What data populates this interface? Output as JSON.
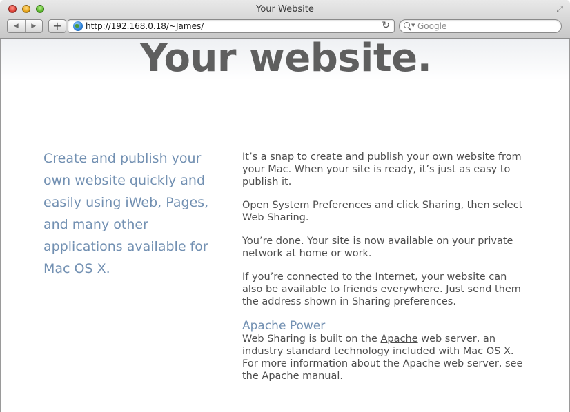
{
  "window": {
    "title": "Your Website"
  },
  "toolbar": {
    "back_icon": "back-arrow-icon",
    "forward_icon": "forward-arrow-icon",
    "add_label": "+",
    "address": "http://192.168.0.18/~James/",
    "search_placeholder": "Google"
  },
  "page": {
    "headline": "Your website.",
    "tagline": "Create and publish your own website quickly and easily using iWeb, Pages, and many other applications available for Mac OS X.",
    "paragraphs": [
      "It’s a snap to create and publish your own website from your Mac. When your site is ready, it’s just as easy to publish it.",
      "Open System Preferences and click Sharing, then select Web Sharing.",
      "You’re done. Your site is now available on your private network at home or work.",
      "If you’re connected to the Internet, your website can also be available to friends everywhere. Just send them the address shown in Sharing preferences."
    ],
    "apache": {
      "heading": "Apache Power",
      "text_before_link1": "Web Sharing is built on the ",
      "link1": "Apache",
      "text_after_link1": " web server, an industry standard technology included with Mac OS X. For more information about the Apache web server, see the ",
      "link2": "Apache manual",
      "text_end": "."
    }
  },
  "colors": {
    "headline": "#5f5f5f",
    "accent_blue": "#7290b2",
    "body_text": "#4e4e4e"
  }
}
